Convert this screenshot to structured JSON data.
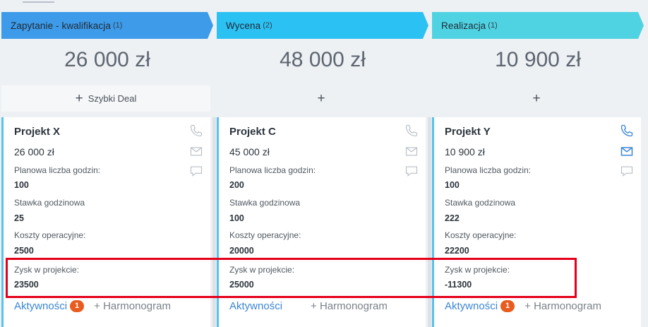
{
  "stages": [
    {
      "name": "Zapytanie - kwalifikacja",
      "count": "(1)",
      "color": "#3d9be9",
      "total": "26 000 zł",
      "add_label": "Szybki Deal",
      "card": {
        "title": "Projekt X",
        "value": "26 000 zł",
        "fields": [
          {
            "label": "Planowa liczba godzin:",
            "value": "100"
          },
          {
            "label": "Stawka godzinowa",
            "value": "25"
          },
          {
            "label": "Koszty operacyjne:",
            "value": "2500"
          },
          {
            "label": "Zysk w projekcie:",
            "value": "23500"
          }
        ],
        "activities_label": "Aktywności",
        "activities_count": "1",
        "schedule_label": "+ Harmonogram",
        "icons_active": false
      }
    },
    {
      "name": "Wycena",
      "count": "(2)",
      "color": "#2bc1f3",
      "total": "48 000 zł",
      "add_label": "",
      "card": {
        "title": "Projekt C",
        "value": "45 000 zł",
        "fields": [
          {
            "label": "Planowa liczba godzin:",
            "value": "200"
          },
          {
            "label": "Stawka godzinowa",
            "value": "100"
          },
          {
            "label": "Koszty operacyjne:",
            "value": "20000"
          },
          {
            "label": "Zysk w projekcie:",
            "value": "25000"
          }
        ],
        "activities_label": "Aktywności",
        "activities_count": "",
        "schedule_label": "+ Harmonogram",
        "icons_active": false
      }
    },
    {
      "name": "Realizacja",
      "count": "(1)",
      "color": "#4fd3e2",
      "total": "10 900 zł",
      "add_label": "",
      "card": {
        "title": "Projekt Y",
        "value": "10 900 zł",
        "fields": [
          {
            "label": "Planowa liczba godzin:",
            "value": "100"
          },
          {
            "label": "Stawka godzinowa",
            "value": "222"
          },
          {
            "label": "Koszty operacyjne:",
            "value": "22200"
          },
          {
            "label": "Zysk w projekcie:",
            "value": "-11300"
          }
        ],
        "activities_label": "Aktywności",
        "activities_count": "1",
        "schedule_label": "+ Harmonogram",
        "icons_active": true
      }
    }
  ],
  "colors": {
    "icon_inactive": "#b8bfc6",
    "icon_active": "#3b86d6",
    "highlight": "#e5001a"
  }
}
